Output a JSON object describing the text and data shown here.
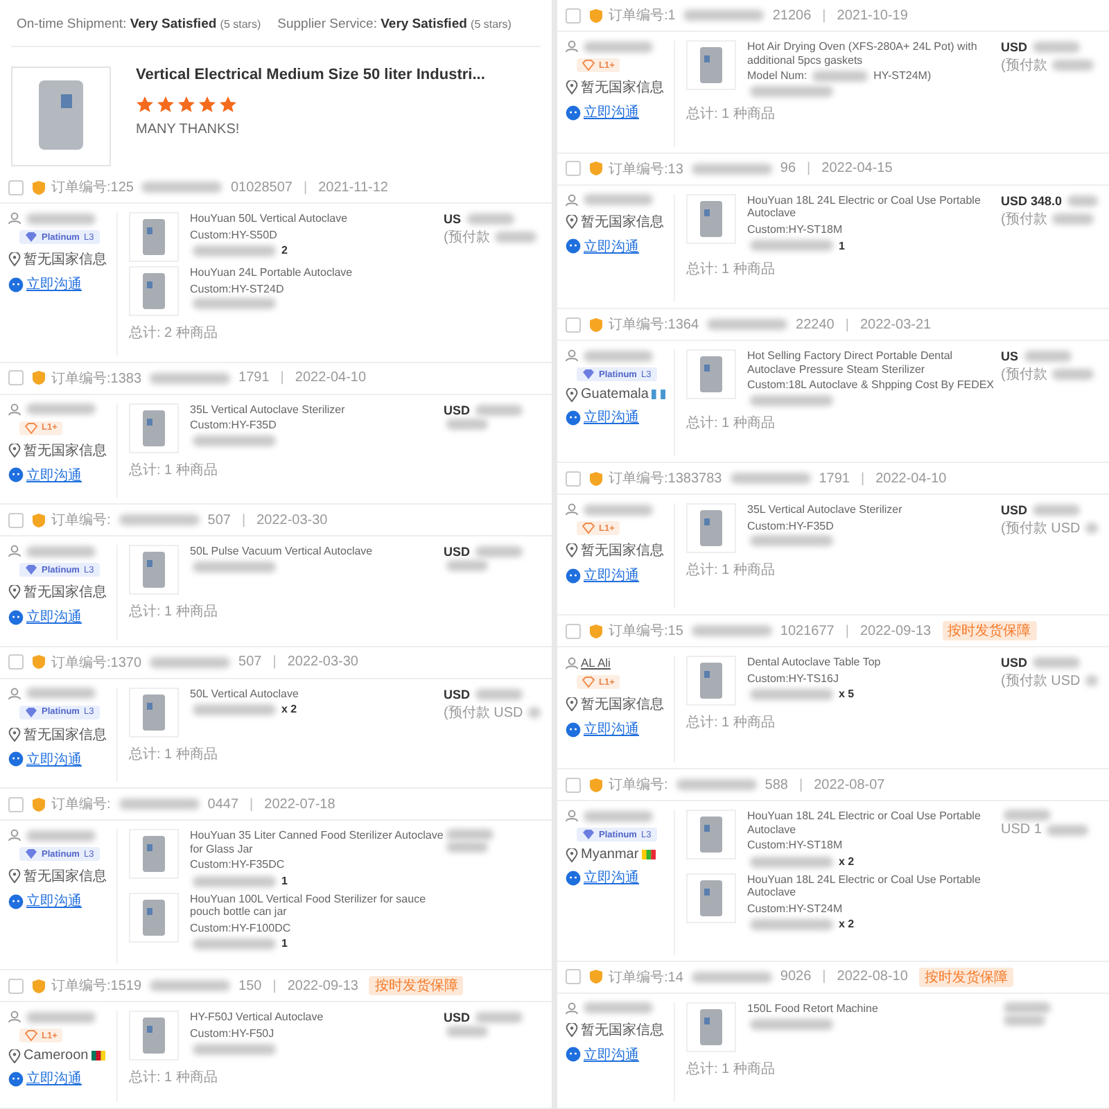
{
  "left_column": {
    "review": {
      "ratings": [
        {
          "label": "On-time Shipment:",
          "value": "Very Satisfied",
          "note": "(5 stars)"
        },
        {
          "label": "Supplier Service:",
          "value": "Very Satisfied",
          "note": "(5 stars)"
        }
      ],
      "product_title": "Vertical Electrical Medium Size 50 liter Industri...",
      "stars": 5,
      "comment": "MANY THANKS!"
    },
    "blocks": [
      {
        "kind": "header",
        "checked": false,
        "number_start": "订单编号:125",
        "number_end": "01028507",
        "separator": "|",
        "date": "2021-11-12"
      },
      {
        "kind": "body",
        "tier": {
          "kind": "platinum",
          "label": "Platinum",
          "level": "L3"
        },
        "location": "暂无国家信息",
        "chat": "立即沟通",
        "items": [
          {
            "title": "HouYuan 50L Vertical Autoclave",
            "spec": "Custom:HY-S50D",
            "qty": "2"
          },
          {
            "title": "HouYuan 24L Portable Autoclave",
            "spec": "Custom:HY-ST24D"
          }
        ],
        "total": "总计: 2 种商品",
        "price": "US",
        "price_note": "(预付款"
      },
      {
        "kind": "header",
        "checked": false,
        "number_start": "订单编号:1383",
        "number_end": "1791",
        "separator": "|",
        "date": "2022-04-10"
      },
      {
        "kind": "body",
        "tier": {
          "kind": "l1",
          "label": "L1+"
        },
        "location": "暂无国家信息",
        "chat": "立即沟通",
        "items": [
          {
            "title": "35L Vertical Autoclave Sterilizer",
            "spec": "Custom:HY-F35D"
          }
        ],
        "total": "总计: 1 种商品",
        "price": "USD"
      },
      {
        "kind": "header",
        "checked": false,
        "number_start": "订单编号:",
        "number_end": "507",
        "separator": "|",
        "date": "2022-03-30"
      },
      {
        "kind": "body",
        "tier": {
          "kind": "platinum",
          "label": "Platinum",
          "level": "L3"
        },
        "location": "暂无国家信息",
        "chat": "立即沟通",
        "items": [
          {
            "title": "50L Pulse Vacuum Vertical Autoclave"
          }
        ],
        "total": "总计: 1 种商品",
        "price": "USD"
      },
      {
        "kind": "header",
        "checked": false,
        "number_start": "订单编号:1370",
        "number_end": "507",
        "separator": "|",
        "date": "2022-03-30"
      },
      {
        "kind": "body",
        "tier": {
          "kind": "platinum",
          "label": "Platinum",
          "level": "L3"
        },
        "location": "暂无国家信息",
        "chat": "立即沟通",
        "items": [
          {
            "title": "50L Vertical Autoclave",
            "qty": "x 2"
          }
        ],
        "total": "总计: 1 种商品",
        "price": "USD",
        "price_note": "(预付款 USD"
      },
      {
        "kind": "header",
        "checked": false,
        "number_start": "订单编号:",
        "number_end": "0447",
        "separator": "|",
        "date": "2022-07-18"
      },
      {
        "kind": "body",
        "tier": {
          "kind": "platinum",
          "label": "Platinum",
          "level": "L3"
        },
        "location": "暂无国家信息",
        "chat": "立即沟通",
        "items": [
          {
            "title": "HouYuan 35 Liter Canned Food Sterilizer Autoclave for Glass Jar",
            "spec": "Custom:HY-F35DC",
            "qty": "1"
          },
          {
            "title": "HouYuan 100L Vertical Food Sterilizer for sauce pouch bottle can jar",
            "spec": "Custom:HY-F100DC",
            "qty": "1"
          }
        ]
      },
      {
        "kind": "header",
        "checked": false,
        "number_start": "订单编号:1519",
        "number_end": "150",
        "separator": "|",
        "date": "2022-09-13",
        "badge": "按时发货保障"
      },
      {
        "kind": "body",
        "tier": {
          "kind": "l1",
          "label": "L1+"
        },
        "location": "Cameroon",
        "flag": {
          "kind": "cm"
        },
        "chat": "立即沟通",
        "items": [
          {
            "title": "HY-F50J Vertical Autoclave",
            "spec": "Custom:HY-F50J"
          }
        ],
        "total": "总计: 1 种商品",
        "price": "USD"
      }
    ]
  },
  "right_column": {
    "blocks": [
      {
        "kind": "header",
        "checked": false,
        "number_start": "订单编号:1",
        "number_end": "21206",
        "separator": "|",
        "date": "2021-10-19"
      },
      {
        "kind": "body",
        "tier": {
          "kind": "l1",
          "label": "L1+"
        },
        "location": "暂无国家信息",
        "chat": "立即沟通",
        "items": [
          {
            "title": "Hot Air Drying Oven (XFS-280A+ 24L Pot) with additional 5pcs gaskets",
            "spec": "Model Num:",
            "spec_end": "HY-ST24M)"
          }
        ],
        "total": "总计: 1 种商品",
        "price": "USD",
        "price_note": "(预付款"
      },
      {
        "kind": "header",
        "checked": false,
        "number_start": "订单编号:13",
        "number_end": "96",
        "separator": "|",
        "date": "2022-04-15"
      },
      {
        "kind": "body",
        "location": "暂无国家信息",
        "chat": "立即沟通",
        "items": [
          {
            "title": "HouYuan 18L 24L Electric or Coal Use Portable Autoclave",
            "spec": "Custom:HY-ST18M",
            "qty": "1"
          }
        ],
        "total": "总计: 1 种商品",
        "price": "USD 348.0",
        "price_note": "(预付款"
      },
      {
        "kind": "header",
        "checked": false,
        "number_start": "订单编号:1364",
        "number_end": "22240",
        "separator": "|",
        "date": "2022-03-21"
      },
      {
        "kind": "body",
        "tier": {
          "kind": "platinum",
          "label": "Platinum",
          "level": "L3"
        },
        "location": "Guatemala",
        "flag": {
          "kind": "gt"
        },
        "chat": "立即沟通",
        "items": [
          {
            "title": "Hot Selling Factory Direct Portable Dental Autoclave Pressure Steam Sterilizer",
            "spec": "Custom:18L Autoclave & Shpping Cost By FEDEX"
          }
        ],
        "total": "总计: 1 种商品",
        "price": "US",
        "price_note": "(预付款"
      },
      {
        "kind": "header",
        "checked": false,
        "number_start": "订单编号:1383783",
        "number_end": "1791",
        "separator": "|",
        "date": "2022-04-10"
      },
      {
        "kind": "body",
        "tier": {
          "kind": "l1",
          "label": "L1+"
        },
        "location": "暂无国家信息",
        "chat": "立即沟通",
        "items": [
          {
            "title": "35L Vertical Autoclave Sterilizer",
            "spec": "Custom:HY-F35D"
          }
        ],
        "total": "总计: 1 种商品",
        "price": "USD",
        "price_note": "(预付款 USD"
      },
      {
        "kind": "header",
        "checked": false,
        "number_start": "订单编号:15",
        "number_end": "1021677",
        "separator": "|",
        "date": "2022-09-13",
        "badge": "按时发货保障"
      },
      {
        "kind": "body",
        "name": "AL Ali",
        "tier": {
          "kind": "l1",
          "label": "L1+"
        },
        "location": "暂无国家信息",
        "chat": "立即沟通",
        "items": [
          {
            "title": "Dental Autoclave Table Top",
            "spec": "Custom:HY-TS16J",
            "qty": "x 5"
          }
        ],
        "total": "总计: 1 种商品",
        "price": "USD",
        "price_note": "(预付款 USD"
      },
      {
        "kind": "header",
        "checked": false,
        "number_start": "订单编号:",
        "number_end": "588",
        "separator": "|",
        "date": "2022-08-07"
      },
      {
        "kind": "body",
        "tier": {
          "kind": "platinum",
          "label": "Platinum",
          "level": "L3"
        },
        "location": "Myanmar",
        "flag": {
          "kind": "mm"
        },
        "chat": "立即沟通",
        "items": [
          {
            "title": "HouYuan 18L 24L Electric or Coal Use Portable Autoclave",
            "spec": "Custom:HY-ST18M",
            "qty": "x 2"
          },
          {
            "title": "HouYuan 18L 24L Electric or Coal Use Portable Autoclave",
            "spec": "Custom:HY-ST24M",
            "qty": "x 2"
          }
        ],
        "price_note": "USD 1"
      },
      {
        "kind": "header",
        "checked": false,
        "number_start": "订单编号:14",
        "number_end": "9026",
        "separator": "|",
        "date": "2022-08-10",
        "badge": "按时发货保障"
      },
      {
        "kind": "body",
        "location": "暂无国家信息",
        "chat": "立即沟通",
        "items": [
          {
            "title": "150L Food Retort Machine"
          }
        ],
        "total": "总计: 1 种商品"
      }
    ]
  }
}
